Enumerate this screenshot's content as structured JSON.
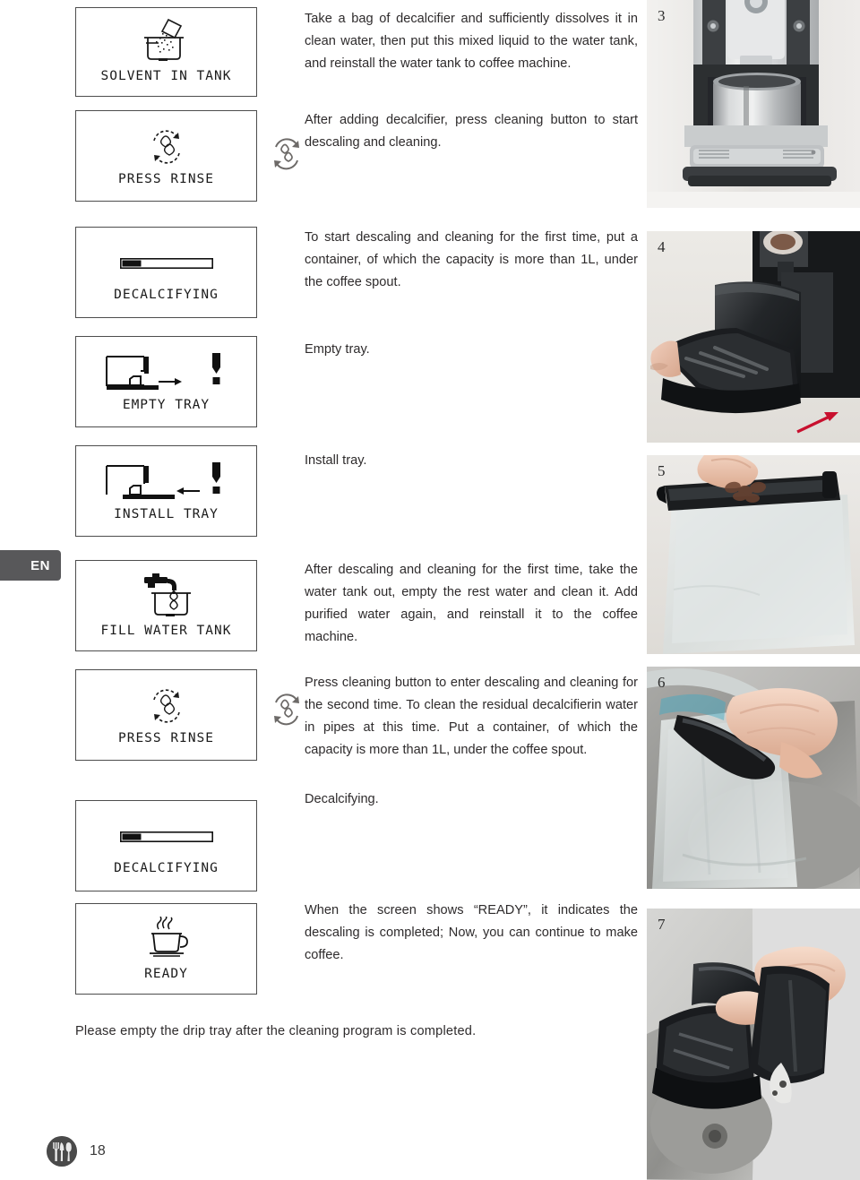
{
  "language_tab": {
    "label": "EN"
  },
  "page_footer": {
    "page_number": "18",
    "logo": "cutlery-circle-logo"
  },
  "footer_note": "Please empty the drip tray after the cleaning program is completed.",
  "steps": [
    {
      "panel_label": "SOLVENT IN TANK",
      "panel_icon": "powder-into-tank-icon",
      "text": "Take a bag of decalcifier and sufficiently dissolves it in clean water, then put this mixed liquid to the water tank, and reinstall the water tank to coffee machine.",
      "button_icon": null
    },
    {
      "panel_label": "PRESS RINSE",
      "panel_icon": "rinse-cycle-icon",
      "text": "After adding decalcifier, press cleaning button to start descaling and cleaning.",
      "button_icon": "rinse-button-icon"
    },
    {
      "panel_label": "DECALCIFYING",
      "panel_icon": "progress-bar-icon",
      "text": "To start descaling and cleaning for the first time, put a container, of which the capacity is more than 1L, under the coffee spout.",
      "button_icon": null
    },
    {
      "panel_label": "EMPTY TRAY",
      "panel_icon": "empty-tray-icon",
      "text": "Empty tray.",
      "button_icon": null
    },
    {
      "panel_label": "INSTALL TRAY",
      "panel_icon": "install-tray-icon",
      "text": "Install tray.",
      "button_icon": null
    },
    {
      "panel_label": "FILL WATER TANK",
      "panel_icon": "faucet-fill-tank-icon",
      "text": "After descaling and cleaning for the first time, take the water tank out, empty the rest water and clean it. Add purified water again, and reinstall it to the coffee machine.",
      "button_icon": null
    },
    {
      "panel_label": "PRESS RINSE",
      "panel_icon": "rinse-cycle-icon",
      "text": "Press cleaning button to enter descaling and cleaning for the second time. To clean the residual decalcifierin water in pipes at this time. Put a container, of which the capacity is more than 1L, under the coffee spout.",
      "button_icon": "rinse-button-icon"
    },
    {
      "panel_label": "DECALCIFYING",
      "panel_icon": "progress-bar-icon",
      "text": "Decalcifying.",
      "button_icon": null
    },
    {
      "panel_label": "READY",
      "panel_icon": "coffee-cup-icon",
      "text": "When the screen shows “READY”, it indicates the descaling is completed; Now, you can continue to make coffee.",
      "button_icon": null
    }
  ],
  "photos": [
    {
      "number": "3",
      "caption": "coffee-machine-with-pitcher-under-spout"
    },
    {
      "number": "4",
      "caption": "hand-removing-drip-tray-with-red-arrow"
    },
    {
      "number": "5",
      "caption": "hand-holding-water-tank-lid"
    },
    {
      "number": "6",
      "caption": "hand-rinsing-water-tank-in-sink"
    },
    {
      "number": "7",
      "caption": "hands-emptying-drip-tray-over-sink"
    }
  ],
  "colors": {
    "tab_background": "#58585a",
    "panel_border": "#4d4d4d",
    "text": "#2e2b2c",
    "arrow_red": "#c8102e",
    "icon_gray": "#6d6a68"
  }
}
